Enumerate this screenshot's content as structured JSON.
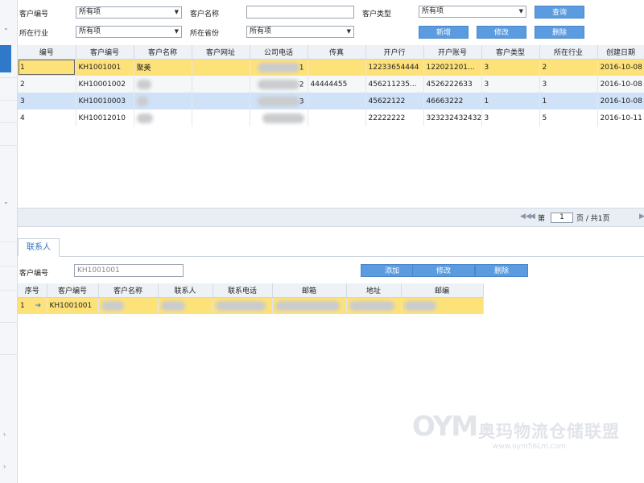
{
  "filters": {
    "customer_code_label": "客户编号",
    "customer_code_value": "所有项",
    "customer_name_label": "客户名称",
    "customer_name_value": "",
    "customer_type_label": "客户类型",
    "customer_type_value": "所有项",
    "industry_label": "所在行业",
    "industry_value": "所有项",
    "province_label": "所在省份",
    "province_value": "所有项"
  },
  "buttons": {
    "query": "查询",
    "add": "新增",
    "edit": "修改",
    "delete": "删除"
  },
  "customer_grid": {
    "columns": [
      "编号",
      "客户编号",
      "客户名称",
      "客户网址",
      "公司电话",
      "传真",
      "开户行",
      "开户账号",
      "客户类型",
      "所在行业",
      "创建日期"
    ],
    "rows": [
      {
        "no": "1",
        "code": "KH1001001",
        "name": "聚美",
        "website": "",
        "phone": "1",
        "fax": "",
        "bank": "12233654444",
        "account": "122021201...",
        "type": "3",
        "industry": "2",
        "date": "2016-10-08"
      },
      {
        "no": "2",
        "code": "KH10001002",
        "name": "",
        "website": "",
        "phone": "2",
        "fax": "44444455",
        "bank": "456211235...",
        "account": "4526222633",
        "type": "3",
        "industry": "3",
        "date": "2016-10-08"
      },
      {
        "no": "3",
        "code": "KH10010003",
        "name": "",
        "website": "",
        "phone": "3",
        "fax": "",
        "bank": "45622122",
        "account": "46663222",
        "type": "1",
        "industry": "1",
        "date": "2016-10-08"
      },
      {
        "no": "4",
        "code": "KH10012010",
        "name": "",
        "website": "",
        "phone": "",
        "fax": "",
        "bank": "22222222",
        "account": "323232432432",
        "type": "3",
        "industry": "5",
        "date": "2016-10-11"
      }
    ]
  },
  "pager": {
    "first_icon": "first-page-icon",
    "prev_icon": "prev-page-icon",
    "page_prefix": "第",
    "page_value": "1",
    "page_suffix": "页 / 共1页"
  },
  "contact_tab": {
    "label": "联系人",
    "customer_code_label": "客户编号",
    "customer_code_value": "KH1001001",
    "add": "添加",
    "edit": "修改",
    "delete": "删除"
  },
  "contact_grid": {
    "columns": [
      "序号",
      "客户编号",
      "客户名称",
      "联系人",
      "联系电话",
      "邮箱",
      "地址",
      "邮编"
    ],
    "rows": [
      {
        "no": "1",
        "code": "KH1001001",
        "name": "",
        "contact": "",
        "phone": "",
        "email": "",
        "address": "",
        "zip": ""
      }
    ]
  },
  "watermark": {
    "logo": "OYM",
    "text": "奥玛物流仓储联盟",
    "url": "www.oym56Lm.com"
  },
  "colors": {
    "button": "#5b9bdf",
    "selected_row": "#fde27a",
    "blue_row": "#cfe2f7",
    "tab_text": "#2f6fb8"
  }
}
